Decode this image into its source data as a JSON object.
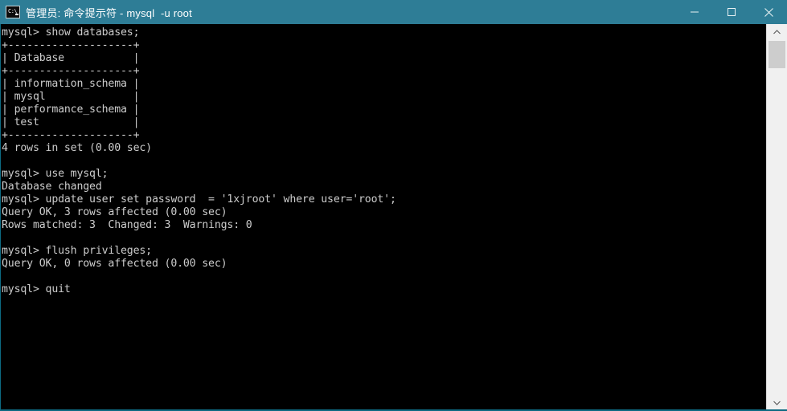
{
  "window": {
    "title": "管理员: 命令提示符 - mysql  -u root",
    "icon": "console-icon",
    "icon_glyph": "C:\\",
    "titlebar_color": "#2e7d96",
    "background_color": "#000000",
    "foreground_color": "#cccccc",
    "controls": {
      "minimize_label": "Minimize",
      "maximize_label": "Maximize",
      "close_label": "Close"
    }
  },
  "scrollbar": {
    "up_arrow": "▲",
    "down_arrow": "▼",
    "position": "top"
  },
  "terminal": {
    "prompt": "mysql>",
    "lines": [
      "mysql> show databases;",
      "+--------------------+",
      "| Database           |",
      "+--------------------+",
      "| information_schema |",
      "| mysql              |",
      "| performance_schema |",
      "| test               |",
      "+--------------------+",
      "4 rows in set (0.00 sec)",
      "",
      "mysql> use mysql;",
      "Database changed",
      "mysql> update user set password  = '1xjroot' where user='root';",
      "Query OK, 3 rows affected (0.00 sec)",
      "Rows matched: 3  Changed: 3  Warnings: 0",
      "",
      "mysql> flush privileges;",
      "Query OK, 0 rows affected (0.00 sec)",
      "",
      "mysql> quit"
    ],
    "commands": [
      "show databases;",
      "use mysql;",
      "update user set password  = '1xjroot' where user='root';",
      "flush privileges;",
      "quit"
    ],
    "result_table": {
      "header": "Database",
      "rows": [
        "information_schema",
        "mysql",
        "performance_schema",
        "test"
      ],
      "row_count_text": "4 rows in set (0.00 sec)"
    },
    "status_messages": [
      "Database changed",
      "Query OK, 3 rows affected (0.00 sec)",
      "Rows matched: 3  Changed: 3  Warnings: 0",
      "Query OK, 0 rows affected (0.00 sec)"
    ]
  }
}
